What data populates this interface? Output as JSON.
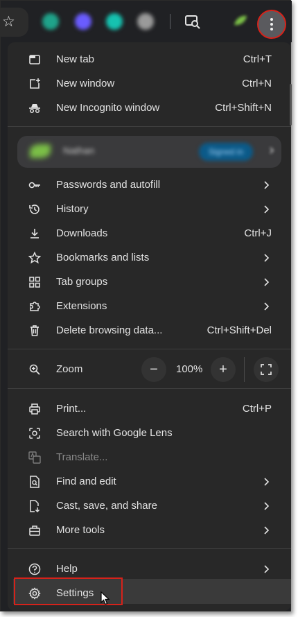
{
  "toolbar": {
    "star_icon": "☆",
    "extension_colors": [
      "#1fa38a",
      "#6a5cff",
      "#16c2b0",
      "#9a9a9a"
    ],
    "menu_button": "more-vert-icon"
  },
  "menu": {
    "new_tab": {
      "label": "New tab",
      "shortcut": "Ctrl+T"
    },
    "new_window": {
      "label": "New window",
      "shortcut": "Ctrl+N"
    },
    "new_incognito": {
      "label": "New Incognito window",
      "shortcut": "Ctrl+Shift+N"
    },
    "profile": {
      "name": "Nathan",
      "status": "Signed in"
    },
    "passwords": {
      "label": "Passwords and autofill"
    },
    "history": {
      "label": "History"
    },
    "downloads": {
      "label": "Downloads",
      "shortcut": "Ctrl+J"
    },
    "bookmarks": {
      "label": "Bookmarks and lists"
    },
    "tab_groups": {
      "label": "Tab groups"
    },
    "extensions": {
      "label": "Extensions"
    },
    "delete_data": {
      "label": "Delete browsing data...",
      "shortcut": "Ctrl+Shift+Del"
    },
    "zoom": {
      "label": "Zoom",
      "value": "100%",
      "minus": "−",
      "plus": "+"
    },
    "print": {
      "label": "Print...",
      "shortcut": "Ctrl+P"
    },
    "google_lens": {
      "label": "Search with Google Lens"
    },
    "translate": {
      "label": "Translate..."
    },
    "find_edit": {
      "label": "Find and edit"
    },
    "cast_save_share": {
      "label": "Cast, save, and share"
    },
    "more_tools": {
      "label": "More tools"
    },
    "help": {
      "label": "Help"
    },
    "settings": {
      "label": "Settings"
    }
  },
  "colors": {
    "highlight_outline": "#d6221a",
    "menu_bg": "#282828",
    "text": "#e3e3e3"
  }
}
